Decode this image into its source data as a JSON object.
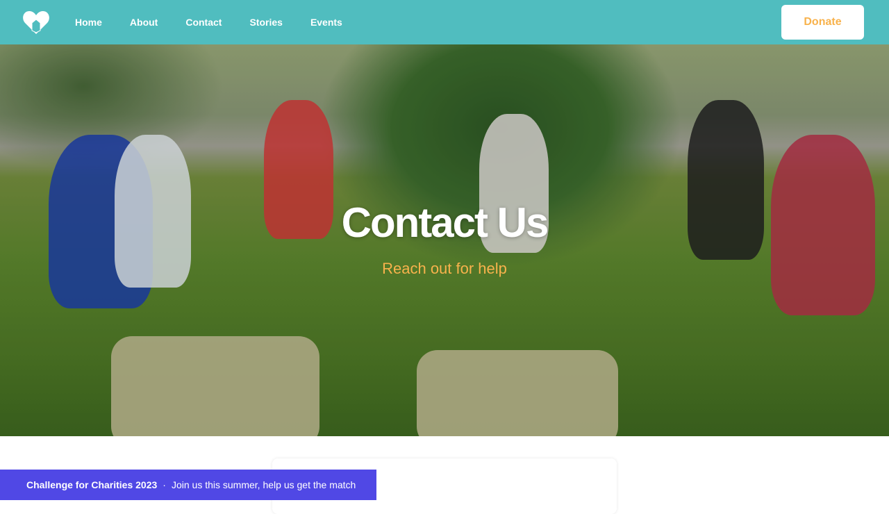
{
  "nav": {
    "logo_icon": "heart-house-icon",
    "links": [
      "Home",
      "About",
      "Contact",
      "Stories",
      "Events"
    ],
    "donate": "Donate"
  },
  "hero": {
    "title": "Contact Us",
    "subtitle": "Reach out for help"
  },
  "banner": {
    "title": "Challenge for Charities 2023",
    "separator": "·",
    "text": "Join us this summer, help us get the match"
  },
  "colors": {
    "nav": "#50bdbf",
    "accent": "#f8b24c",
    "banner": "#5048e5"
  }
}
